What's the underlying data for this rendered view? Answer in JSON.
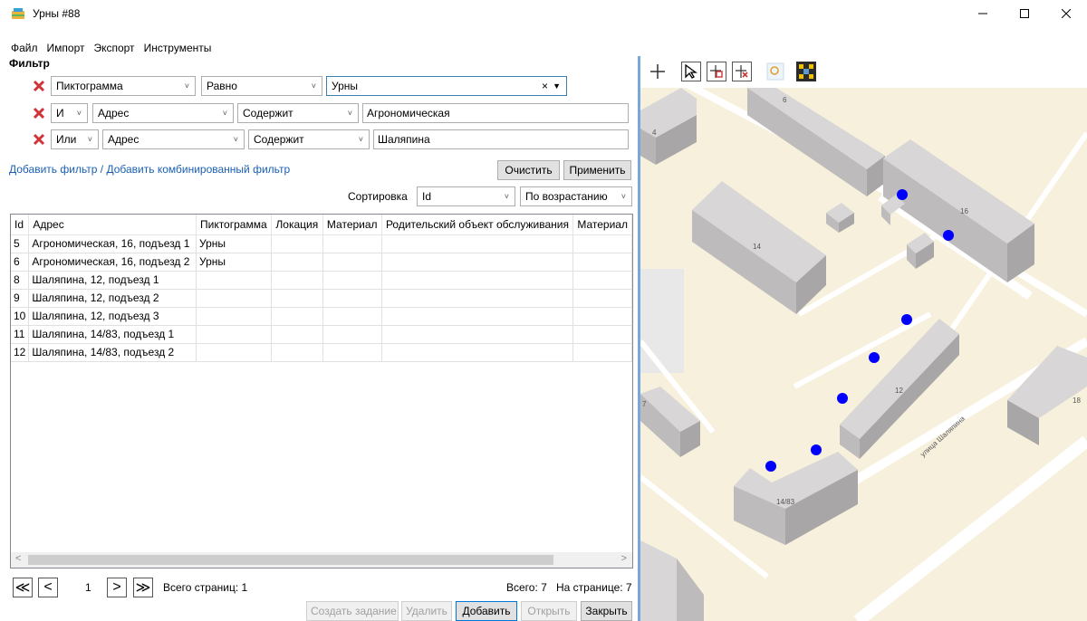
{
  "window": {
    "title": "Урны #88",
    "minimize": "—",
    "maximize": "☐",
    "close": "✕"
  },
  "menu": [
    "Файл",
    "Импорт",
    "Экспорт",
    "Инструменты"
  ],
  "filter": {
    "label": "Фильтр",
    "rows": [
      {
        "connector": "",
        "field": "Пиктограмма",
        "operator": "Равно",
        "value": "Урны",
        "value_type": "combo"
      },
      {
        "connector": "И",
        "field": "Адрес",
        "operator": "Содержит",
        "value": "Агрономическая",
        "value_type": "text"
      },
      {
        "connector": "Или",
        "field": "Адрес",
        "operator": "Содержит",
        "value": "Шаляпина",
        "value_type": "text"
      }
    ],
    "clear_value": "×",
    "add_filter": "Добавить фильтр",
    "separator": "/",
    "add_combined": "Добавить комбинированный фильтр",
    "clear_button": "Очистить",
    "apply_button": "Применить"
  },
  "sort": {
    "label": "Сортировка",
    "field": "Id",
    "order": "По возрастанию"
  },
  "grid": {
    "columns": [
      "Id",
      "Адрес",
      "Пиктограмма",
      "Локация",
      "Материал",
      "Родительский объект обслуживания",
      "Материал"
    ],
    "rows": [
      [
        "5",
        "Агрономическая, 16, подъезд 1",
        "Урны",
        "",
        "",
        "",
        ""
      ],
      [
        "6",
        "Агрономическая, 16, подъезд 2",
        "Урны",
        "",
        "",
        "",
        ""
      ],
      [
        "8",
        "Шаляпина, 12, подъезд 1",
        "",
        "",
        "",
        "",
        ""
      ],
      [
        "9",
        "Шаляпина, 12, подъезд 2",
        "",
        "",
        "",
        "",
        ""
      ],
      [
        "10",
        "Шаляпина, 12, подъезд 3",
        "",
        "",
        "",
        "",
        ""
      ],
      [
        "11",
        "Шаляпина, 14/83, подъезд 1",
        "",
        "",
        "",
        "",
        ""
      ],
      [
        "12",
        "Шаляпина, 14/83, подъезд 2",
        "",
        "",
        "",
        "",
        ""
      ]
    ]
  },
  "pager": {
    "first": "≪",
    "prev": "<",
    "page": "1",
    "next": ">",
    "last": "≫",
    "total_pages": "Всего страниц: 1",
    "total": "Всего: 7",
    "per_page": "На странице: 7"
  },
  "actions": {
    "create_task": "Создать задание",
    "delete": "Удалить",
    "add": "Добавить",
    "open": "Открыть",
    "close": "Закрыть"
  },
  "map": {
    "tools": [
      "add-tool",
      "select-tool",
      "add-point-tool",
      "delete-point-tool",
      "zoom-tool",
      "fit-extent-tool"
    ],
    "buildings": [
      "6",
      "4",
      "16",
      "14",
      "12",
      "14/83",
      "7",
      "18"
    ],
    "street": "улица Шаляпина",
    "marker_color": "#0000ff",
    "marker_count": 7
  }
}
